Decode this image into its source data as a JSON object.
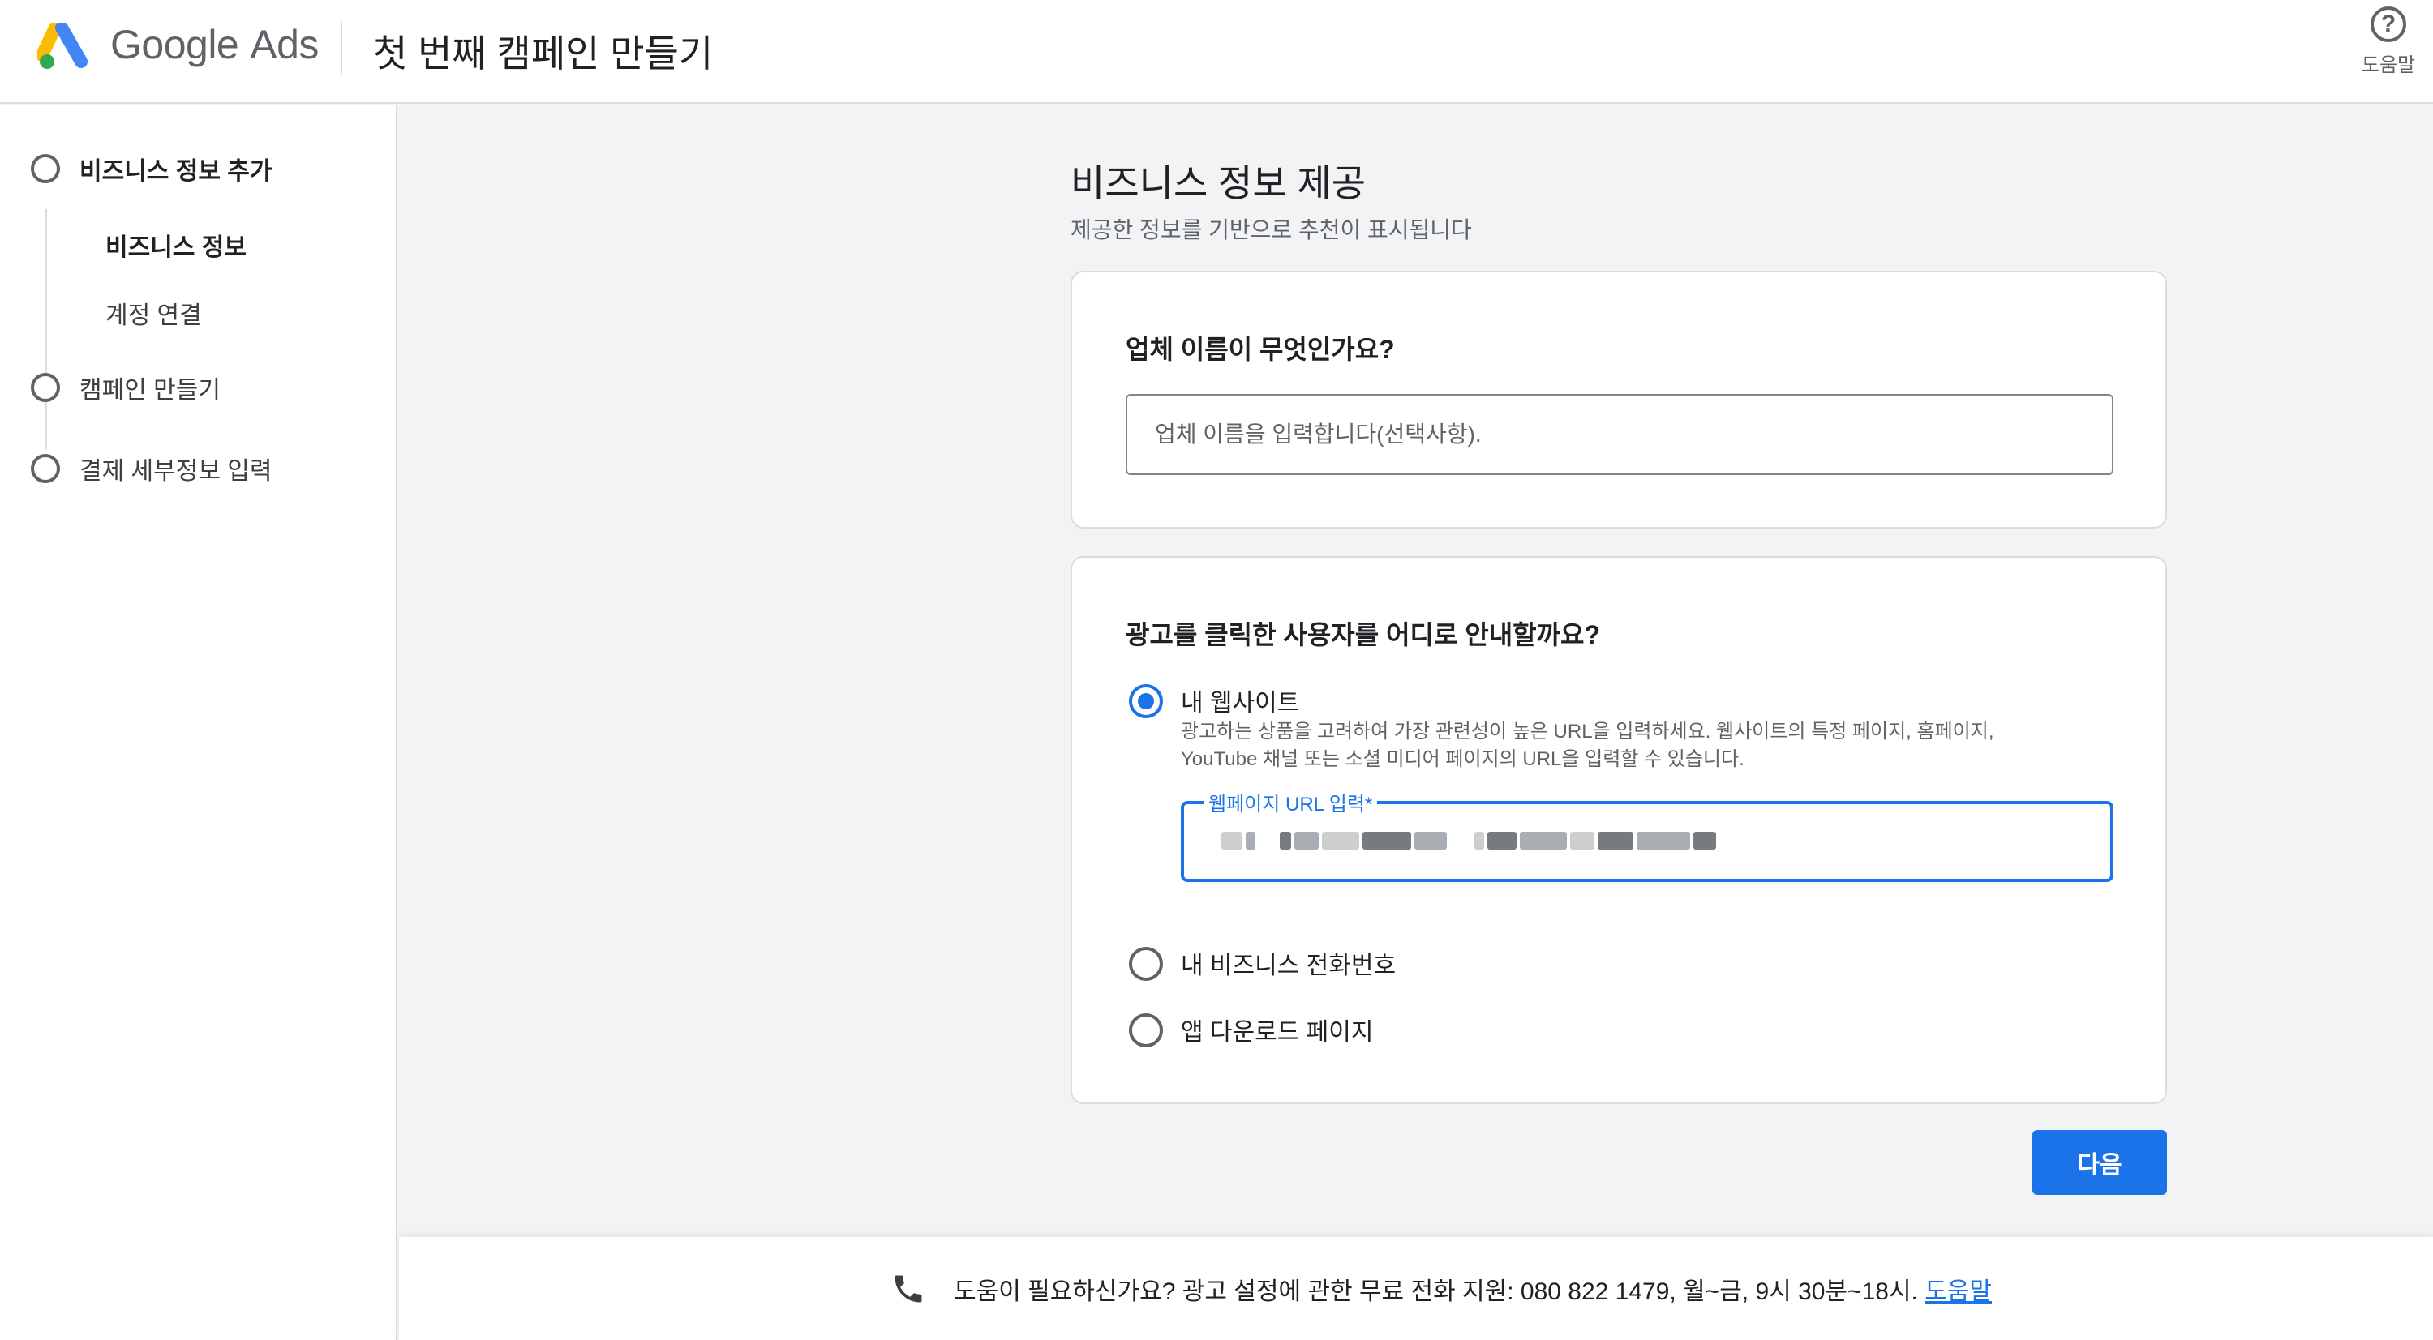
{
  "header": {
    "brand_google": "Google",
    "brand_ads": "Ads",
    "title": "첫 번째 캠페인 만들기",
    "help_label": "도움말"
  },
  "sidebar": {
    "steps": [
      {
        "label": "비즈니스 정보 추가"
      },
      {
        "label": "캠페인 만들기"
      },
      {
        "label": "결제 세부정보 입력"
      }
    ],
    "substeps": [
      {
        "label": "비즈니스 정보"
      },
      {
        "label": "계정 연결"
      }
    ]
  },
  "main": {
    "title": "비즈니스 정보 제공",
    "subtitle": "제공한 정보를 기반으로 추천이 표시됩니다",
    "business_name": {
      "question": "업체 이름이 무엇인가요?",
      "placeholder": "업체 이름을 입력합니다(선택사항)."
    },
    "destination": {
      "question": "광고를 클릭한 사용자를 어디로 안내할까요?",
      "options": [
        {
          "label": "내 웹사이트",
          "selected": true
        },
        {
          "label": "내 비즈니스 전화번호",
          "selected": false
        },
        {
          "label": "앱 다운로드 페이지",
          "selected": false
        }
      ],
      "website_desc": "광고하는 상품을 고려하여 가장 관련성이 높은 URL을 입력하세요. 웹사이트의 특정 페이지, 홈페이지, YouTube 채널 또는 소셜 미디어 페이지의 URL을 입력할 수 있습니다.",
      "url_label": "웹페이지 URL 입력*"
    },
    "next_label": "다음"
  },
  "footer": {
    "text": "도움이 필요하신가요? 광고 설정에 관한 무료 전화 지원: 080 822 1479, 월~금, 9시 30분~18시.",
    "link": "도움말"
  },
  "colors": {
    "accent": "#1a73e8",
    "logo_blue": "#4285f4",
    "logo_yellow": "#fbbc04",
    "logo_green": "#34a853"
  }
}
